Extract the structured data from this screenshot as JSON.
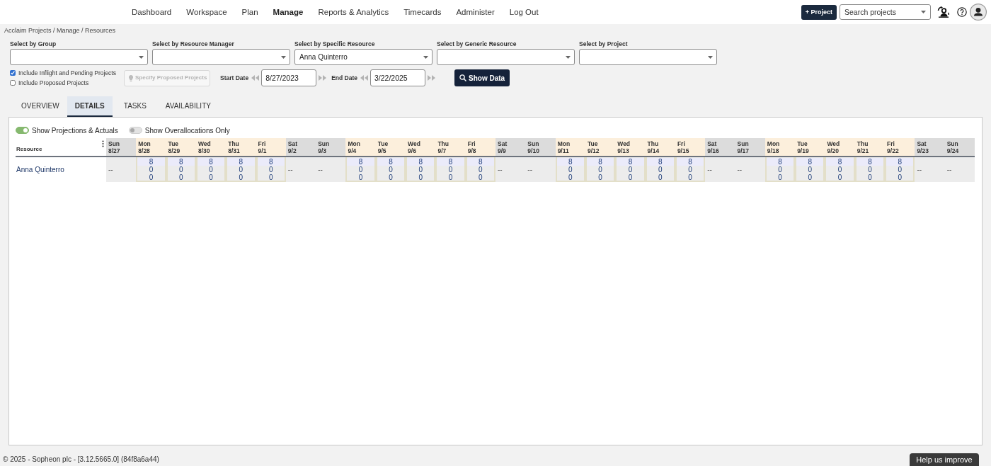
{
  "nav": {
    "items": [
      {
        "label": "Dashboard",
        "selected": false
      },
      {
        "label": "Workspace",
        "selected": false
      },
      {
        "label": "Plan",
        "selected": false
      },
      {
        "label": "Manage",
        "selected": true
      },
      {
        "label": "Reports & Analytics",
        "selected": false
      },
      {
        "label": "Timecards",
        "selected": false
      },
      {
        "label": "Administer",
        "selected": false
      },
      {
        "label": "Log Out",
        "selected": false
      }
    ],
    "add_button": {
      "label": "+ Project"
    },
    "search": {
      "placeholder": "Search projects"
    }
  },
  "breadcrumb": "Acclaim Projects / Manage / Resources",
  "filters": [
    {
      "label": "Select by Group"
    },
    {
      "label": "Select by Resource Manager"
    },
    {
      "label": "Select by Specific Resource",
      "value": "Anna Quinterro"
    },
    {
      "label": "Select by Generic Resource"
    },
    {
      "label": "Select by Project"
    }
  ],
  "options": [
    {
      "label": "Include Inflight and Pending Projects",
      "checked": true
    },
    {
      "label": "Include Proposed Projects",
      "checked": false
    }
  ],
  "specify_button": {
    "label": "Specify Proposed Projects",
    "disabled": true
  },
  "dates": [
    {
      "label": "Start Date",
      "value": "8/27/2023"
    },
    {
      "label": "End Date",
      "value": "3/22/2025"
    }
  ],
  "show_button": {
    "label": "Show Data"
  },
  "tabs": [
    {
      "label": "OVERVIEW",
      "selected": false
    },
    {
      "label": "DETAILS",
      "selected": true
    },
    {
      "label": "TASKS",
      "selected": false
    },
    {
      "label": "AVAILABILITY",
      "selected": false
    }
  ],
  "toggles": [
    {
      "label": "Show Projections & Actuals",
      "on": true
    },
    {
      "label": "Show Overallocations Only",
      "on": false
    }
  ],
  "grid": {
    "resource_header": "Resource",
    "days": [
      {
        "weekday": "Sun",
        "date": "8/27",
        "weekend": true
      },
      {
        "weekday": "Mon",
        "date": "8/28",
        "weekend": false
      },
      {
        "weekday": "Tue",
        "date": "8/29",
        "weekend": false
      },
      {
        "weekday": "Wed",
        "date": "8/30",
        "weekend": false
      },
      {
        "weekday": "Thu",
        "date": "8/31",
        "weekend": false
      },
      {
        "weekday": "Fri",
        "date": "9/1",
        "weekend": false
      },
      {
        "weekday": "Sat",
        "date": "9/2",
        "weekend": true
      },
      {
        "weekday": "Sun",
        "date": "9/3",
        "weekend": true
      },
      {
        "weekday": "Mon",
        "date": "9/4",
        "weekend": false
      },
      {
        "weekday": "Tue",
        "date": "9/5",
        "weekend": false
      },
      {
        "weekday": "Wed",
        "date": "9/6",
        "weekend": false
      },
      {
        "weekday": "Thu",
        "date": "9/7",
        "weekend": false
      },
      {
        "weekday": "Fri",
        "date": "9/8",
        "weekend": false
      },
      {
        "weekday": "Sat",
        "date": "9/9",
        "weekend": true
      },
      {
        "weekday": "Sun",
        "date": "9/10",
        "weekend": true
      },
      {
        "weekday": "Mon",
        "date": "9/11",
        "weekend": false
      },
      {
        "weekday": "Tue",
        "date": "9/12",
        "weekend": false
      },
      {
        "weekday": "Wed",
        "date": "9/13",
        "weekend": false
      },
      {
        "weekday": "Thu",
        "date": "9/14",
        "weekend": false
      },
      {
        "weekday": "Fri",
        "date": "9/15",
        "weekend": false
      },
      {
        "weekday": "Sat",
        "date": "9/16",
        "weekend": true
      },
      {
        "weekday": "Sun",
        "date": "9/17",
        "weekend": true
      },
      {
        "weekday": "Mon",
        "date": "9/18",
        "weekend": false
      },
      {
        "weekday": "Tue",
        "date": "9/19",
        "weekend": false
      },
      {
        "weekday": "Wed",
        "date": "9/20",
        "weekend": false
      },
      {
        "weekday": "Thu",
        "date": "9/21",
        "weekend": false
      },
      {
        "weekday": "Fri",
        "date": "9/22",
        "weekend": false
      },
      {
        "weekday": "Sat",
        "date": "9/23",
        "weekend": true
      },
      {
        "weekday": "Sun",
        "date": "9/24",
        "weekend": true
      }
    ],
    "rows": [
      {
        "resource": "Anna Quinterro",
        "cells": [
          {
            "kind": "empty",
            "text": "--"
          },
          {
            "kind": "hours",
            "values": [
              "8",
              "0",
              "0"
            ]
          },
          {
            "kind": "hours",
            "values": [
              "8",
              "0",
              "0"
            ]
          },
          {
            "kind": "hours",
            "values": [
              "8",
              "0",
              "0"
            ]
          },
          {
            "kind": "hours",
            "values": [
              "8",
              "0",
              "0"
            ]
          },
          {
            "kind": "hours",
            "values": [
              "8",
              "0",
              "0"
            ]
          },
          {
            "kind": "empty",
            "text": "--"
          },
          {
            "kind": "empty",
            "text": "--"
          },
          {
            "kind": "hours",
            "values": [
              "8",
              "0",
              "0"
            ]
          },
          {
            "kind": "hours",
            "values": [
              "8",
              "0",
              "0"
            ]
          },
          {
            "kind": "hours",
            "values": [
              "8",
              "0",
              "0"
            ]
          },
          {
            "kind": "hours",
            "values": [
              "8",
              "0",
              "0"
            ]
          },
          {
            "kind": "hours",
            "values": [
              "8",
              "0",
              "0"
            ]
          },
          {
            "kind": "empty",
            "text": "--"
          },
          {
            "kind": "empty",
            "text": "--"
          },
          {
            "kind": "hours",
            "values": [
              "8",
              "0",
              "0"
            ]
          },
          {
            "kind": "hours",
            "values": [
              "8",
              "0",
              "0"
            ]
          },
          {
            "kind": "hours",
            "values": [
              "8",
              "0",
              "0"
            ]
          },
          {
            "kind": "hours",
            "values": [
              "8",
              "0",
              "0"
            ]
          },
          {
            "kind": "hours",
            "values": [
              "8",
              "0",
              "0"
            ]
          },
          {
            "kind": "empty",
            "text": "--"
          },
          {
            "kind": "empty",
            "text": "--"
          },
          {
            "kind": "hours",
            "values": [
              "8",
              "0",
              "0"
            ]
          },
          {
            "kind": "hours",
            "values": [
              "8",
              "0",
              "0"
            ]
          },
          {
            "kind": "hours",
            "values": [
              "8",
              "0",
              "0"
            ]
          },
          {
            "kind": "hours",
            "values": [
              "8",
              "0",
              "0"
            ]
          },
          {
            "kind": "hours",
            "values": [
              "8",
              "0",
              "0"
            ]
          },
          {
            "kind": "empty",
            "text": "--"
          },
          {
            "kind": "empty",
            "text": "--"
          }
        ]
      }
    ]
  },
  "footer": {
    "text": "© 2025 - Sopheon plc - [3.12.5665.0] (84f8a6a44)",
    "feedback_button": "Help us improve"
  }
}
